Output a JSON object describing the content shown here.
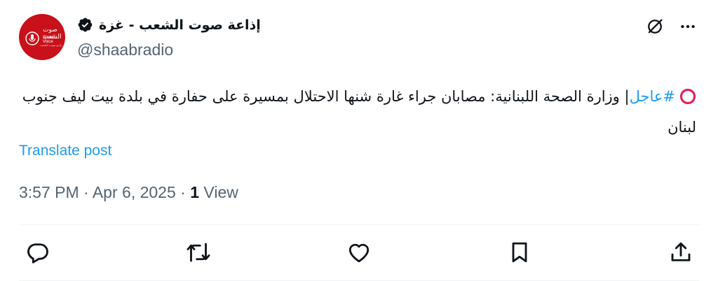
{
  "author": {
    "display_name": "إذاعة صوت الشعب - غزة",
    "handle": "@shaabradio",
    "avatar_text": {
      "arabic": "صوت الشعب",
      "english": "Shaab Voice",
      "tagline": "راديو صوت الشعب"
    },
    "verified": true
  },
  "tweet": {
    "hashtag": "#عاجل",
    "body": "| وزارة الصحة اللبنانية: مصابان جراء غارة شنها الاحتلال بمسيرة على حفارة في بلدة بيت ليف جنوب لبنان",
    "leading_icon": "red-circle-icon"
  },
  "translate_label": "Translate post",
  "meta": {
    "time": "3:57 PM",
    "separator": "·",
    "date": "Apr 6, 2025",
    "views_count": "1",
    "views_label": "View"
  },
  "icons": {
    "top": [
      "grok-icon",
      "more-icon"
    ],
    "actions": [
      "reply-icon",
      "retweet-icon",
      "like-icon",
      "bookmark-icon",
      "share-icon"
    ]
  },
  "colors": {
    "accent": "#1d9bf0",
    "secondary_text": "#536471",
    "primary_text": "#0f1419",
    "avatar_bg": "#c8111b",
    "alert_red": "#e0245e"
  }
}
